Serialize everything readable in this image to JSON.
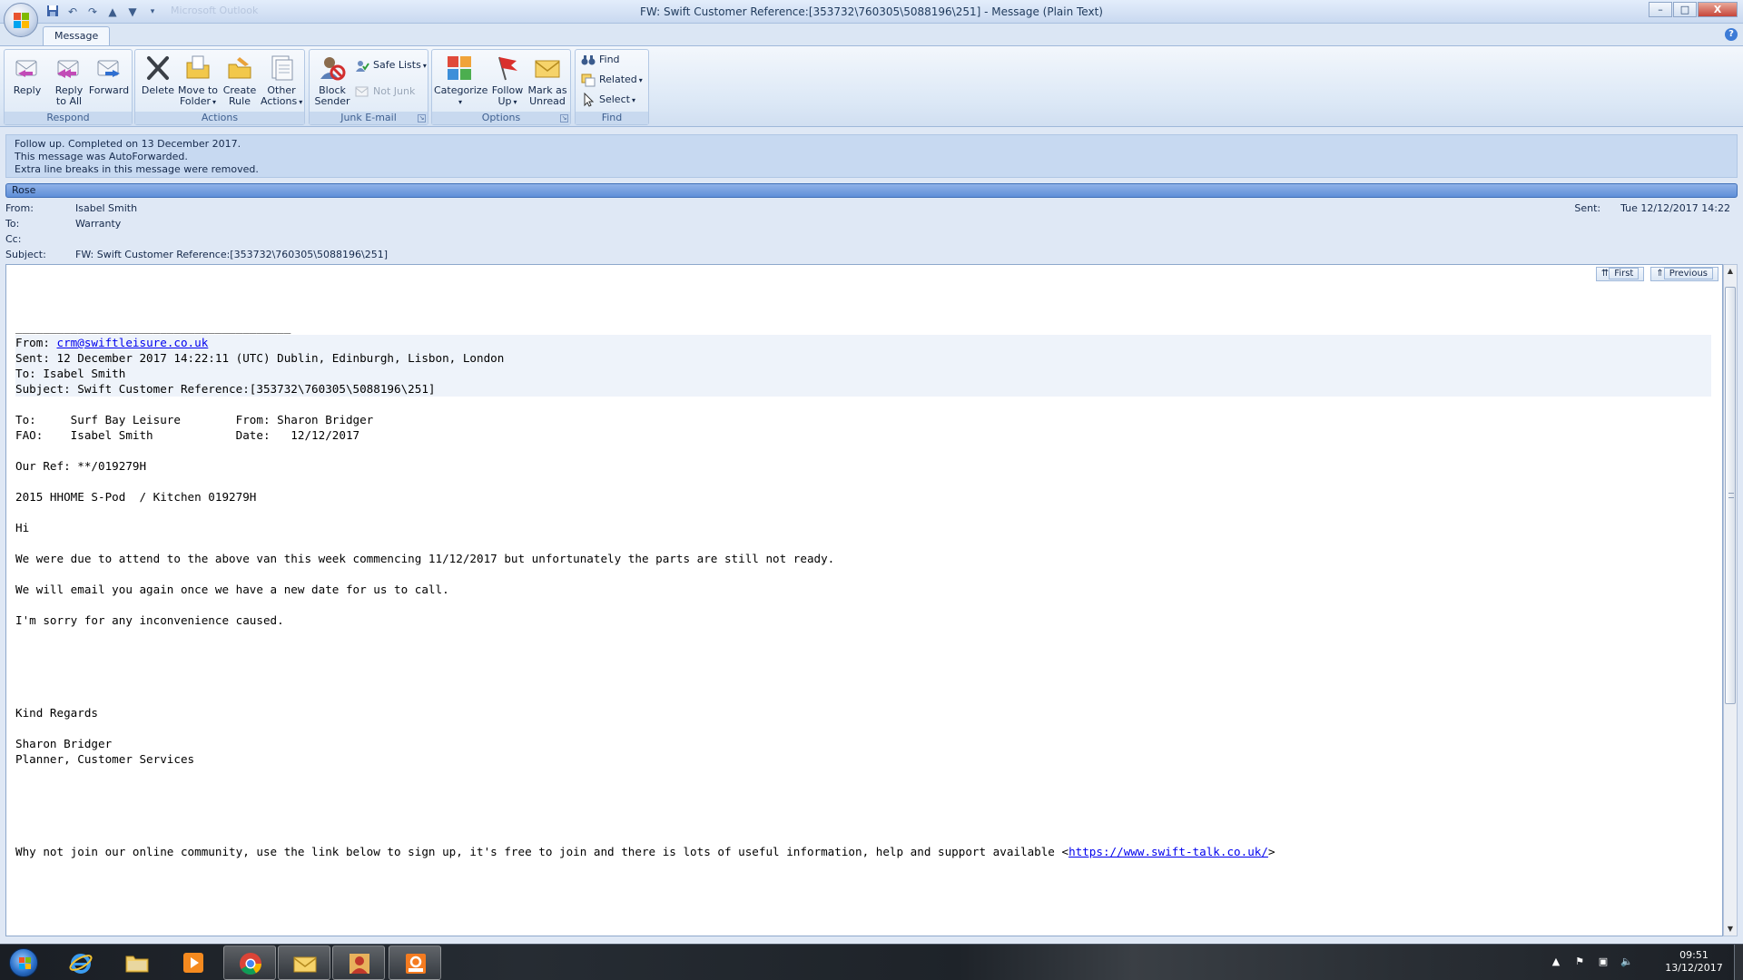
{
  "window": {
    "title": "FW: Swift Customer Reference:[353732\\760305\\5088196\\251] - Message (Plain Text)",
    "ghost_title": "Microsoft Outlook",
    "controls": {
      "minimize": "–",
      "maximize": "□",
      "close": "X"
    }
  },
  "ribbon": {
    "tab": "Message",
    "help": "?",
    "groups": {
      "respond": {
        "label": "Respond",
        "reply": "Reply",
        "reply_all_1": "Reply",
        "reply_all_2": "to All",
        "forward": "Forward"
      },
      "actions": {
        "label": "Actions",
        "delete": "Delete",
        "move_1": "Move to",
        "move_2": "Folder",
        "create_1": "Create",
        "create_2": "Rule",
        "other_1": "Other",
        "other_2": "Actions"
      },
      "junk": {
        "label": "Junk E-mail",
        "block_1": "Block",
        "block_2": "Sender",
        "safe_lists": "Safe Lists",
        "not_junk": "Not Junk"
      },
      "options": {
        "label": "Options",
        "categorize": "Categorize",
        "follow_1": "Follow",
        "follow_2": "Up",
        "mark_1": "Mark as",
        "mark_2": "Unread"
      },
      "find": {
        "label": "Find",
        "find": "Find",
        "related": "Related",
        "select": "Select"
      }
    }
  },
  "infobar": {
    "line1": "Follow up.  Completed on 13 December 2017.",
    "line2": "This message was AutoForwarded.",
    "line3": "Extra line breaks in this message were removed."
  },
  "category": "Rose",
  "header": {
    "from_label": "From:",
    "from": "Isabel Smith",
    "to_label": "To:",
    "to": "Warranty",
    "cc_label": "Cc:",
    "cc": "",
    "subject_label": "Subject:",
    "subject": "FW: Swift Customer Reference:[353732\\760305\\5088196\\251]",
    "sent_label": "Sent:",
    "sent": "Tue 12/12/2017 14:22"
  },
  "nav": {
    "first": "First",
    "previous": "Previous"
  },
  "body": {
    "separator": "________________________________________",
    "fw_from_label": "From: ",
    "fw_from_email": "crm@swiftleisure.co.uk",
    "fw_sent": "Sent: 12 December 2017 14:22:11 (UTC) Dublin, Edinburgh, Lisbon, London",
    "fw_to": "To: Isabel Smith",
    "fw_subject": "Subject: Swift Customer Reference:[353732\\760305\\5088196\\251]",
    "to_line": "To:     Surf Bay Leisure        From: Sharon Bridger",
    "fao_line": "FAO:    Isabel Smith            Date:   12/12/2017",
    "our_ref": "Our Ref: **/019279H",
    "product": "2015 HHOME S-Pod  / Kitchen 019279H",
    "greeting": "Hi",
    "para1": "We were due to attend to the above van this week commencing 11/12/2017 but unfortunately the parts are still not ready.",
    "para2": "We will email you again once we have a new date for us to call.",
    "para3": "I'm sorry for any inconvenience caused.",
    "regards": "Kind Regards",
    "sig_name": "Sharon Bridger",
    "sig_title": "Planner, Customer Services",
    "community_text": "Why not join our online community, use the link below to sign up, it's free to join and there is lots of useful information, help and support available <",
    "community_link": "https://www.swift-talk.co.uk/",
    "community_end": ">"
  },
  "taskbar": {
    "time": "09:51",
    "date": "13/12/2017"
  },
  "colors": {
    "ribbon_bg": "#dce8f6",
    "infobar_bg": "#c7d9f1",
    "category_rose": "#6f9ae0",
    "link": "#0000ee"
  }
}
